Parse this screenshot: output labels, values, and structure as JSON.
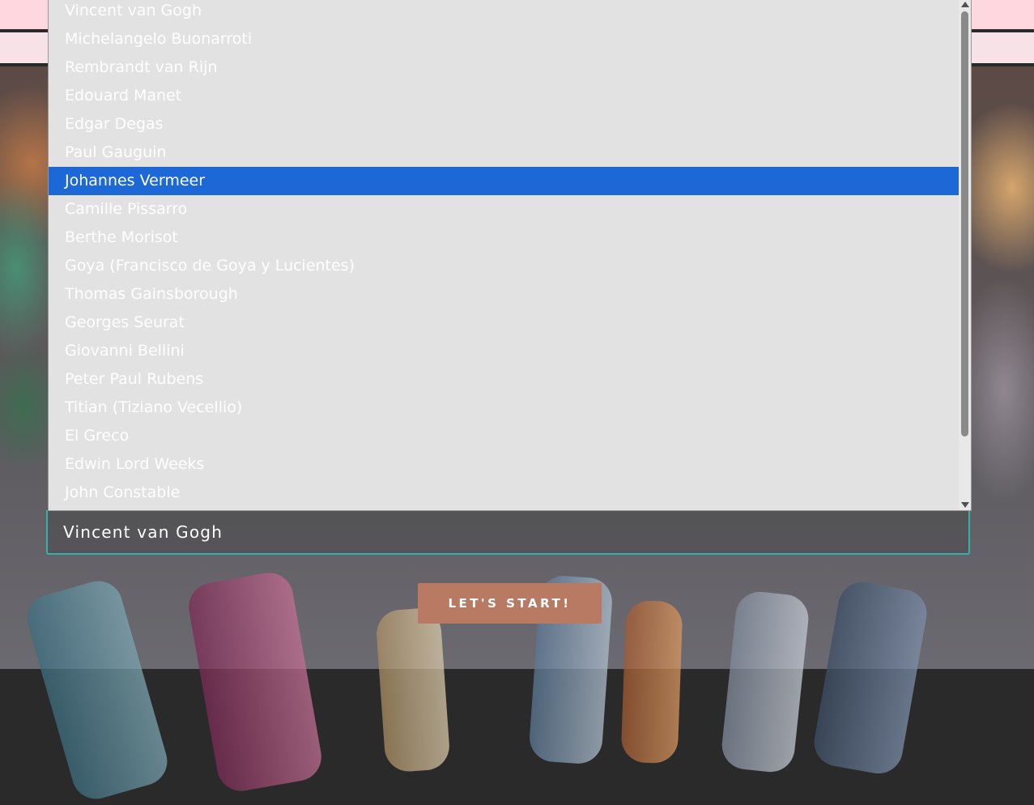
{
  "select": {
    "current_value": "Vincent van Gogh",
    "options": [
      "Vincent van Gogh",
      "Michelangelo Buonarroti",
      "Rembrandt van Rijn",
      "Edouard Manet",
      "Edgar Degas",
      "Paul Gauguin",
      "Johannes Vermeer",
      "Camille Pissarro",
      "Berthe Morisot",
      "Goya (Francisco de Goya y Lucientes)",
      "Thomas Gainsborough",
      "Georges Seurat",
      "Giovanni Bellini",
      "Peter Paul Rubens",
      "Titian (Tiziano Vecellio)",
      "El Greco",
      "Edwin Lord Weeks",
      "John Constable"
    ],
    "highlighted_option": "Johannes Vermeer"
  },
  "start_button": {
    "label": "LET'S START!"
  },
  "colors": {
    "highlight": "#1b68d6",
    "field_border": "#2fb4a6",
    "button": "#b87a62"
  }
}
